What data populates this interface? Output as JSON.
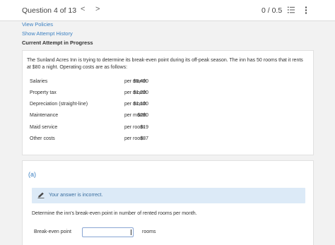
{
  "header": {
    "question_counter": "Question 4 of 13",
    "prev_glyph": "<",
    "next_glyph": ">",
    "score": "0 / 0.5",
    "icons": [
      "list-icon",
      "more-vertical-icon"
    ]
  },
  "links": {
    "view_policies": "View Policies",
    "show_attempt_history": "Show Attempt History"
  },
  "attempt_status": "Current Attempt in Progress",
  "problem": {
    "prompt": "The Sunland Acres Inn is trying to determine its break-even point during its off-peak season. The inn has 50 rooms that it rents at $80 a night. Operating costs are as follows:",
    "costs": [
      {
        "label": "Salaries",
        "amount": "$5,400",
        "period": "per month"
      },
      {
        "label": "Property tax",
        "amount": "$1,200",
        "period": "per month"
      },
      {
        "label": "Depreciation (straight-line)",
        "amount": "$1,100",
        "period": "per month"
      },
      {
        "label": "Maintenance",
        "amount": "$280",
        "period": "per month"
      },
      {
        "label": "Maid service",
        "amount": "$19",
        "period": "per room"
      },
      {
        "label": "Other costs",
        "amount": "$37",
        "period": "per room"
      }
    ]
  },
  "part": {
    "label": "(a)",
    "feedback": "Your answer is incorrect.",
    "question": "Determine the inn's break-even point in number of rented rooms per month.",
    "answer_label": "Break-even point",
    "answer_value": "",
    "unit": "rooms"
  },
  "colors": {
    "link": "#3a7fc1",
    "feedback_bg": "#dceaf7",
    "page_bg": "#f2f2f2"
  }
}
